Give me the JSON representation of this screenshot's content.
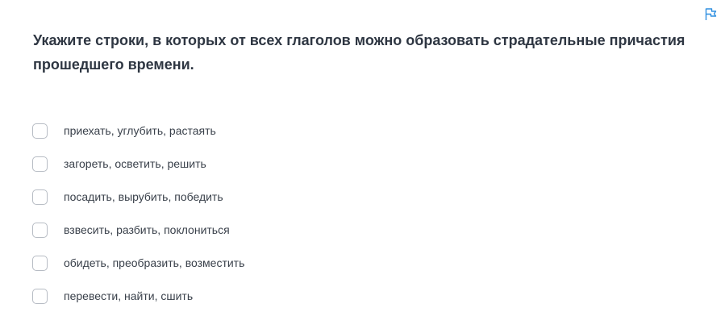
{
  "question": {
    "text": "Укажите строки, в которых от всех глаголов можно образовать страдательные причастия прошедшего времени."
  },
  "flag_icon": "flag-icon",
  "colors": {
    "accent": "#2f8fe0",
    "checkbox_border": "#b7bcc4",
    "text": "#2e3642"
  },
  "options": [
    {
      "label": "приехать, углубить, растаять",
      "checked": false
    },
    {
      "label": "загореть, осветить, решить",
      "checked": false
    },
    {
      "label": "посадить, вырубить, победить",
      "checked": false
    },
    {
      "label": "взвесить, разбить, поклониться",
      "checked": false
    },
    {
      "label": "обидеть, преобразить, возместить",
      "checked": false
    },
    {
      "label": "перевести, найти, сшить",
      "checked": false
    }
  ]
}
